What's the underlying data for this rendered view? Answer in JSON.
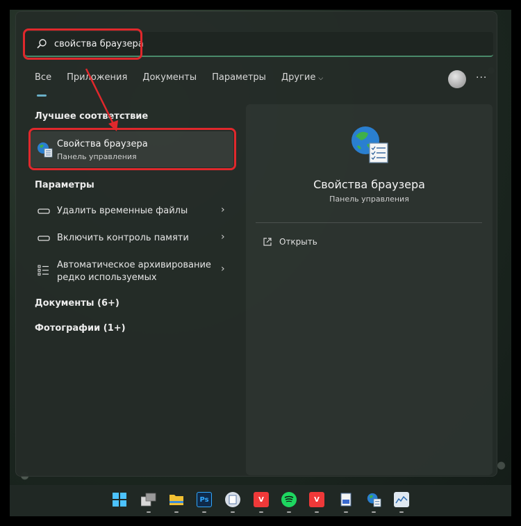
{
  "search": {
    "value": "свойства браузера"
  },
  "tabs": [
    {
      "label": "Все"
    },
    {
      "label": "Приложения"
    },
    {
      "label": "Документы"
    },
    {
      "label": "Параметры"
    },
    {
      "label": "Другие"
    }
  ],
  "more_label": "···",
  "best_match": {
    "section_title": "Лучшее соответствие",
    "title": "Свойства браузера",
    "subtitle": "Панель управления"
  },
  "settings": {
    "section_title": "Параметры",
    "items": [
      {
        "label": "Удалить временные файлы",
        "icon": "storage-icon"
      },
      {
        "label": "Включить контроль памяти",
        "icon": "storage-icon"
      },
      {
        "label_line1": "Автоматическое архивирование",
        "label_line2": "редко используемых",
        "icon": "list-icon"
      }
    ]
  },
  "documents_section": "Документы (6+)",
  "photos_section": "Фотографии (1+)",
  "preview": {
    "title": "Свойства браузера",
    "subtitle": "Панель управления",
    "open_label": "Открыть"
  },
  "taskbar": {
    "photoshop_label": "Ps",
    "vivaldi_label": "V"
  },
  "colors": {
    "highlight": "#e0282c",
    "accent": "#6ab0c8"
  }
}
